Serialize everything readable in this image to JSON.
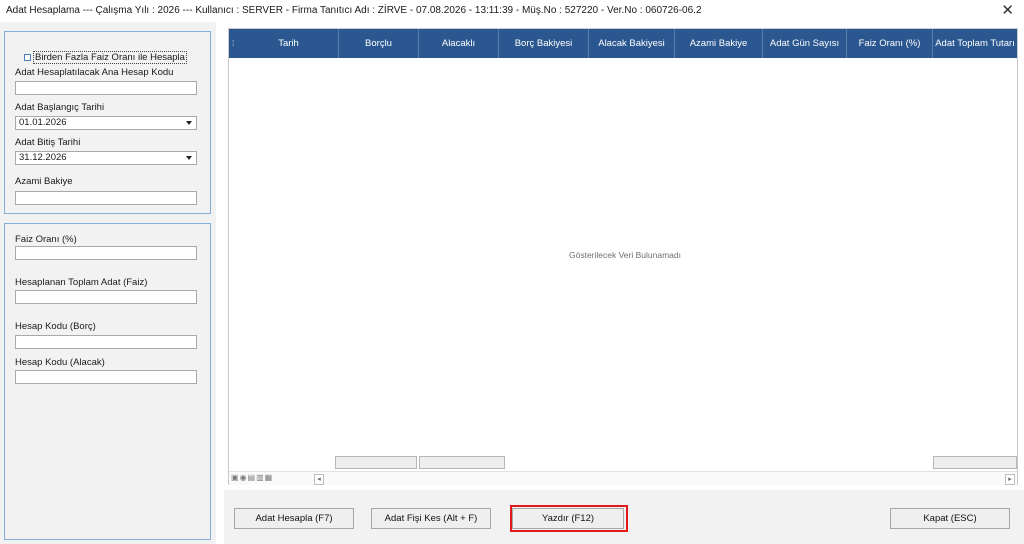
{
  "window": {
    "title": "Adat Hesaplama  ---  Çalışma Yılı : 2026  ---  Kullanıcı : SERVER - Firma Tanıtıcı Adı : ZİRVE - 07.08.2026 - 13:11:39 - Müş.No : 527220 - Ver.No : 060726-06.2",
    "close_symbol": "✕"
  },
  "left_panel": {
    "multi_rate_checkbox": {
      "label": "Birden Fazla Faiz Oranı ile Hesapla",
      "checked": false
    },
    "main_account_code": {
      "label": "Adat Hesaplatılacak Ana Hesap Kodu",
      "value": ""
    },
    "start_date": {
      "label": "Adat Başlangıç Tarihi",
      "value": "01.01.2026"
    },
    "end_date": {
      "label": "Adat Bitiş Tarihi",
      "value": "31.12.2026"
    },
    "max_balance": {
      "label": "Azami Bakiye",
      "value": ""
    }
  },
  "results_panel": {
    "interest_rate": {
      "label": "Faiz Oranı (%)",
      "value": ""
    },
    "total_adat": {
      "label": "Hesaplanan Toplam Adat (Faiz)",
      "value": ""
    },
    "debit_account": {
      "label": "Hesap Kodu (Borç)",
      "value": ""
    },
    "credit_account": {
      "label": "Hesap Kodu (Alacak)",
      "value": ""
    }
  },
  "grid": {
    "row_indicator": "⁞",
    "columns": [
      "Tarih",
      "Borçlu",
      "Alacaklı",
      "Borç Bakiyesi",
      "Alacak Bakiyesi",
      "Azami Bakiye",
      "Adat Gün Sayısı",
      "Faiz Oranı (%)",
      "Adat Toplam Tutarı"
    ],
    "empty_message": "Gösterilecek Veri Bulunamadı",
    "rows": []
  },
  "buttons": {
    "calculate": "Adat Hesapla (F7)",
    "voucher": "Adat Fişi Kes (Alt + F)",
    "print": "Yazdır (F12)",
    "close": "Kapat (ESC)"
  },
  "colors": {
    "grid_header": "#2b5790",
    "panel_border": "#86aed8",
    "highlight": "#e31919"
  }
}
